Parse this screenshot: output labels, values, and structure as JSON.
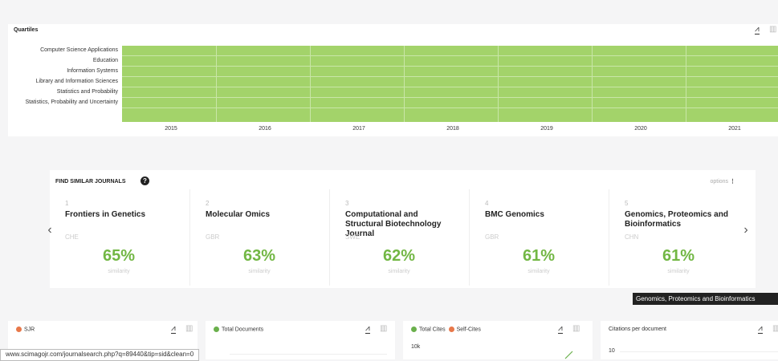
{
  "quartiles": {
    "title": "Quartiles",
    "rows": [
      "Computer Science Applications",
      "Education",
      "Information Systems",
      "Library and Information Sciences",
      "Statistics and Probability",
      "Statistics, Probability and Uncertainty"
    ],
    "years": [
      "2015",
      "2016",
      "2017",
      "2018",
      "2019",
      "2020",
      "2021"
    ],
    "icons": {
      "chart": "trend-chart-icon",
      "table": "table-icon"
    }
  },
  "similar": {
    "title": "FIND SIMILAR JOURNALS",
    "options": "options",
    "cards": [
      {
        "rank": "1",
        "name": "Frontiers in Genetics",
        "country": "CHE",
        "pct": "65%",
        "sim": "similarity"
      },
      {
        "rank": "2",
        "name": "Molecular Omics",
        "country": "GBR",
        "pct": "63%",
        "sim": "similarity"
      },
      {
        "rank": "3",
        "name": "Computational and Structural Biotechnology Journal",
        "country": "SWE",
        "pct": "62%",
        "sim": "similarity"
      },
      {
        "rank": "4",
        "name": "BMC Genomics",
        "country": "GBR",
        "pct": "61%",
        "sim": "similarity"
      },
      {
        "rank": "5",
        "name": "Genomics, Proteomics and Bioinformatics",
        "country": "CHN",
        "pct": "61%",
        "sim": "similarity"
      }
    ],
    "tooltip": "Genomics, Proteomics and Bioinformatics",
    "prev": "‹",
    "next": "›"
  },
  "panels": [
    {
      "title": "SJR",
      "dot": "#e8784a",
      "axis": ""
    },
    {
      "title": "Total Documents",
      "dot": "#6ab04c",
      "axis": ""
    },
    {
      "title": "Total Cites",
      "title2": "Self-Cites",
      "dot": "#6ab04c",
      "dot2": "#e8784a",
      "axis": "10k"
    },
    {
      "title": "Citations per document",
      "dot": "",
      "axis": "10"
    }
  ],
  "status_bar": "www.scimagojr.com/journalsearch.php?q=89440&tip=sid&clean=0",
  "colors": {
    "quartile_fill": "#a3d36a",
    "similarity": "#72b744"
  }
}
